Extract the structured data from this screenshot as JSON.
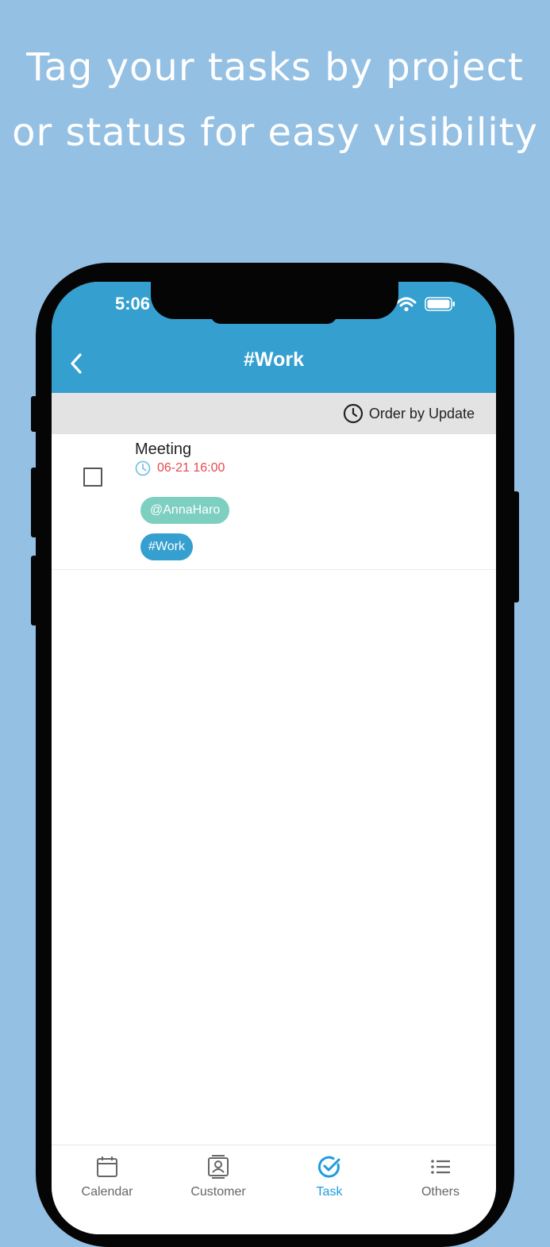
{
  "promo": {
    "line1": "Tag your tasks by project",
    "line2": "or status for easy visibility"
  },
  "status_bar": {
    "time": "5:06"
  },
  "header": {
    "title": "#Work",
    "back_icon": "chevron-left-icon"
  },
  "sort": {
    "label": "Order by Update",
    "icon": "clock-icon"
  },
  "tasks": [
    {
      "title": "Meeting",
      "due": "06-21 16:00",
      "assignee": "@AnnaHaro",
      "tag": "#Work",
      "checked": false
    }
  ],
  "tabs": [
    {
      "label": "Calendar",
      "icon": "calendar-icon",
      "active": false
    },
    {
      "label": "Customer",
      "icon": "contact-card-icon",
      "active": false
    },
    {
      "label": "Task",
      "icon": "check-circle-icon",
      "active": true
    },
    {
      "label": "Others",
      "icon": "list-icon",
      "active": false
    }
  ],
  "colors": {
    "background": "#94c0e4",
    "header": "#359fcf",
    "due_red": "#e8484f",
    "mention_chip": "#7dcfc0",
    "tag_chip": "#359fcf",
    "active_tab": "#1e9be0"
  }
}
